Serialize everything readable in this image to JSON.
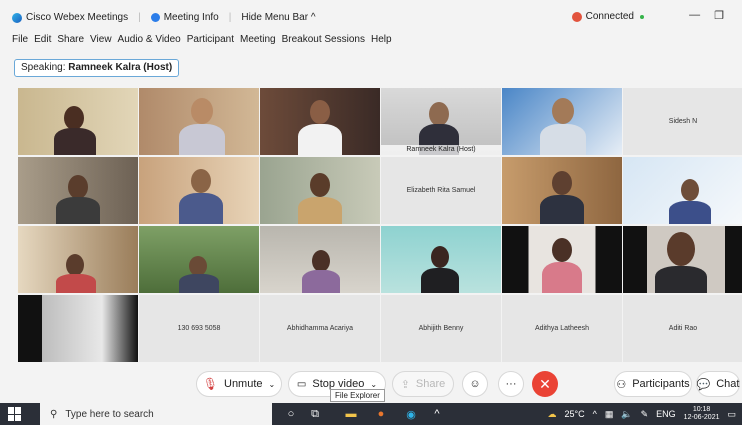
{
  "titlebar": {
    "app_name": "Cisco Webex Meetings",
    "meeting_info": "Meeting Info",
    "hide_menu": "Hide Menu Bar ^",
    "status": "Connected"
  },
  "menu": [
    "File",
    "Edit",
    "Share",
    "View",
    "Audio & Video",
    "Participant",
    "Meeting",
    "Breakout Sessions",
    "Help"
  ],
  "speaking": {
    "prefix": "Speaking:",
    "name": "Ramneek Kalra (Host)"
  },
  "tiles": [
    {
      "label": ""
    },
    {
      "label": ""
    },
    {
      "label": ""
    },
    {
      "label": "Ramneek Kalra (Host)"
    },
    {
      "label": ""
    },
    {
      "name": "Sidesh N"
    },
    {
      "label": ""
    },
    {
      "label": ""
    },
    {
      "label": ""
    },
    {
      "name": "Elizabeth Rita Samuel"
    },
    {
      "label": ""
    },
    {
      "label": ""
    },
    {
      "label": ""
    },
    {
      "label": ""
    },
    {
      "label": ""
    },
    {
      "label": ""
    },
    {
      "label": ""
    },
    {
      "label": ""
    },
    {
      "label": ""
    },
    {
      "name": "130 693 5058"
    },
    {
      "name": "Abhidhamma Acariya"
    },
    {
      "name": "Abhijith Benny"
    },
    {
      "name": "Adithya Latheesh"
    },
    {
      "name": "Aditi Rao"
    }
  ],
  "controls": {
    "unmute": "Unmute",
    "stop_video": "Stop video",
    "share": "Share",
    "participants": "Participants",
    "chat": "Chat",
    "tooltip": "File Explorer"
  },
  "taskbar": {
    "search_placeholder": "Type here to search",
    "temperature": "25°C",
    "language": "ENG",
    "time": "10:18",
    "date": "12-06-2021"
  }
}
